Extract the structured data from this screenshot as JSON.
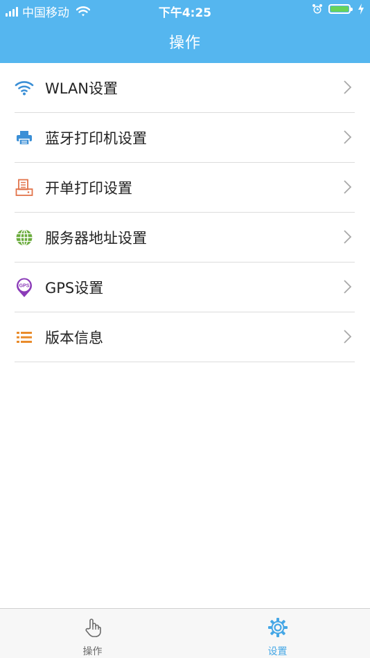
{
  "status_bar": {
    "carrier": "中国移动",
    "time": "下午4:25",
    "battery_color": "#67d35a"
  },
  "header": {
    "title": "操作",
    "background": "#55b6ef"
  },
  "menu": {
    "items": [
      {
        "label": "WLAN设置",
        "icon": "wifi-icon",
        "color": "#3b8fd6"
      },
      {
        "label": "蓝牙打印机设置",
        "icon": "printer-icon",
        "color": "#3b8fd6"
      },
      {
        "label": "开单打印设置",
        "icon": "receipt-printer-icon",
        "color": "#e2734a"
      },
      {
        "label": "服务器地址设置",
        "icon": "globe-icon",
        "color": "#6aab3c"
      },
      {
        "label": "GPS设置",
        "icon": "gps-pin-icon",
        "color": "#8b3bb8"
      },
      {
        "label": "版本信息",
        "icon": "list-icon",
        "color": "#e98b2a"
      }
    ]
  },
  "tabbar": {
    "tabs": [
      {
        "label": "操作",
        "icon": "hand-pointer-icon",
        "active": false
      },
      {
        "label": "设置",
        "icon": "gear-icon",
        "active": true
      }
    ],
    "active_color": "#45a7e6",
    "inactive_color": "#6b6b6b"
  }
}
